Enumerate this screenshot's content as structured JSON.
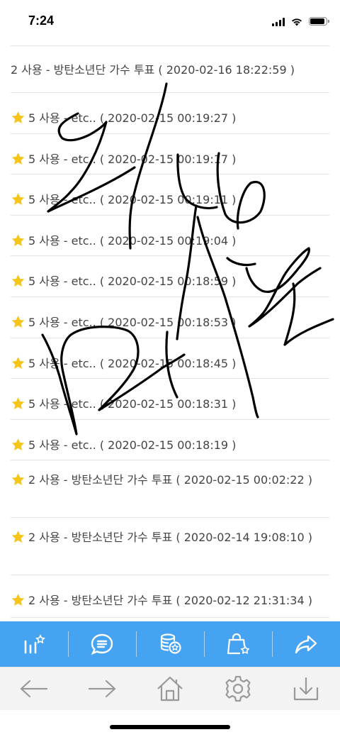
{
  "status": {
    "time": "7:24"
  },
  "rows": [
    {
      "text": "2 사용 - 방탄소년단 가수 투표 ( 2020-02-16 18:22:59 )",
      "starred": false
    },
    {
      "text": "5 사용 - etc.. ( 2020-02-15 00:19:27 )",
      "starred": true
    },
    {
      "text": "5 사용 - etc.. ( 2020-02-15 00:19:17 )",
      "starred": true
    },
    {
      "text": "5 사용 - etc.. ( 2020-02-15 00:19:11 )",
      "starred": true
    },
    {
      "text": "5 사용 - etc.. ( 2020-02-15 00:19:04 )",
      "starred": true
    },
    {
      "text": "5 사용 - etc.. ( 2020-02-15 00:18:59 )",
      "starred": true
    },
    {
      "text": "5 사용 - etc.. ( 2020-02-15 00:18:53 )",
      "starred": true
    },
    {
      "text": "5 사용 - etc.. ( 2020-02-15 00:18:45 )",
      "starred": true
    },
    {
      "text": "5 사용 - etc.. ( 2020-02-15 00:18:31 )",
      "starred": true
    },
    {
      "text": "5 사용 - etc.. ( 2020-02-15 00:18:19 )",
      "starred": true
    },
    {
      "text": "2 사용 - 방탄소년단 가수 투표 ( 2020-02-15 00:02:22 )",
      "starred": true
    },
    {
      "text": "2 사용 - 방탄소년단 가수 투표 ( 2020-02-14 19:08:10 )",
      "starred": true
    },
    {
      "text": "2 사용 - 방탄소년단 가수 투표 ( 2020-02-12 21:31:34 )",
      "starred": true
    }
  ],
  "action_bar": {
    "color": "#46a3f2",
    "icons": [
      "chart-star-icon",
      "chat-bubble-icon",
      "coins-star-icon",
      "shopping-bag-star-icon",
      "share-icon"
    ]
  },
  "nav_bar": {
    "icons": [
      "back-arrow-icon",
      "forward-arrow-icon",
      "home-icon",
      "settings-icon",
      "download-icon"
    ]
  },
  "colors": {
    "star": "#f5c518",
    "divider": "#e3e3e3",
    "text": "#444444"
  }
}
